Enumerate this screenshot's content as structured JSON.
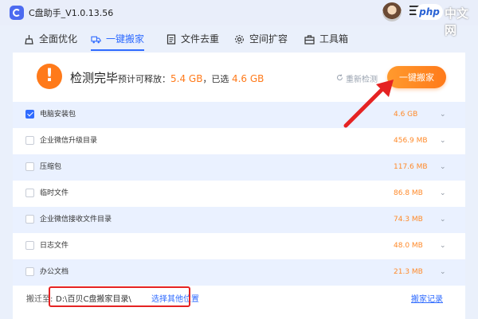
{
  "window": {
    "title": "C盘助手_V1.0.13.56"
  },
  "watermark": {
    "badge": "php",
    "text": "中文网"
  },
  "tabs": [
    {
      "label": "全面优化",
      "icon": "broom-icon"
    },
    {
      "label": "一键搬家",
      "icon": "truck-icon"
    },
    {
      "label": "文件去重",
      "icon": "document-icon"
    },
    {
      "label": "空间扩容",
      "icon": "gear-icon"
    },
    {
      "label": "工具箱",
      "icon": "toolbox-icon"
    }
  ],
  "active_tab": "一键搬家",
  "status": {
    "title": "检测完毕",
    "releasable_label": "预计可释放：",
    "releasable_value": "5.4 GB",
    "selected_label": "，已选",
    "selected_value": "4.6 GB",
    "rescan_label": "重新检测",
    "move_button": "一键搬家"
  },
  "items": [
    {
      "name": "电脑安装包",
      "size": "4.6 GB",
      "checked": true
    },
    {
      "name": "企业微信升级目录",
      "size": "456.9 MB",
      "checked": false
    },
    {
      "name": "压缩包",
      "size": "117.6 MB",
      "checked": false
    },
    {
      "name": "临时文件",
      "size": "86.8 MB",
      "checked": false
    },
    {
      "name": "企业微信接收文件目录",
      "size": "74.3 MB",
      "checked": false
    },
    {
      "name": "日志文件",
      "size": "48.0 MB",
      "checked": false
    },
    {
      "name": "办公文档",
      "size": "21.3 MB",
      "checked": false
    }
  ],
  "footer": {
    "label": "搬迁至:",
    "path": "D:\\百贝C盘搬家目录\\",
    "change_link": "选择其他位置",
    "history_link": "搬家记录"
  },
  "colors": {
    "accent": "#2f6bff",
    "orange": "#ff7a1a",
    "annotation": "#e52323"
  }
}
